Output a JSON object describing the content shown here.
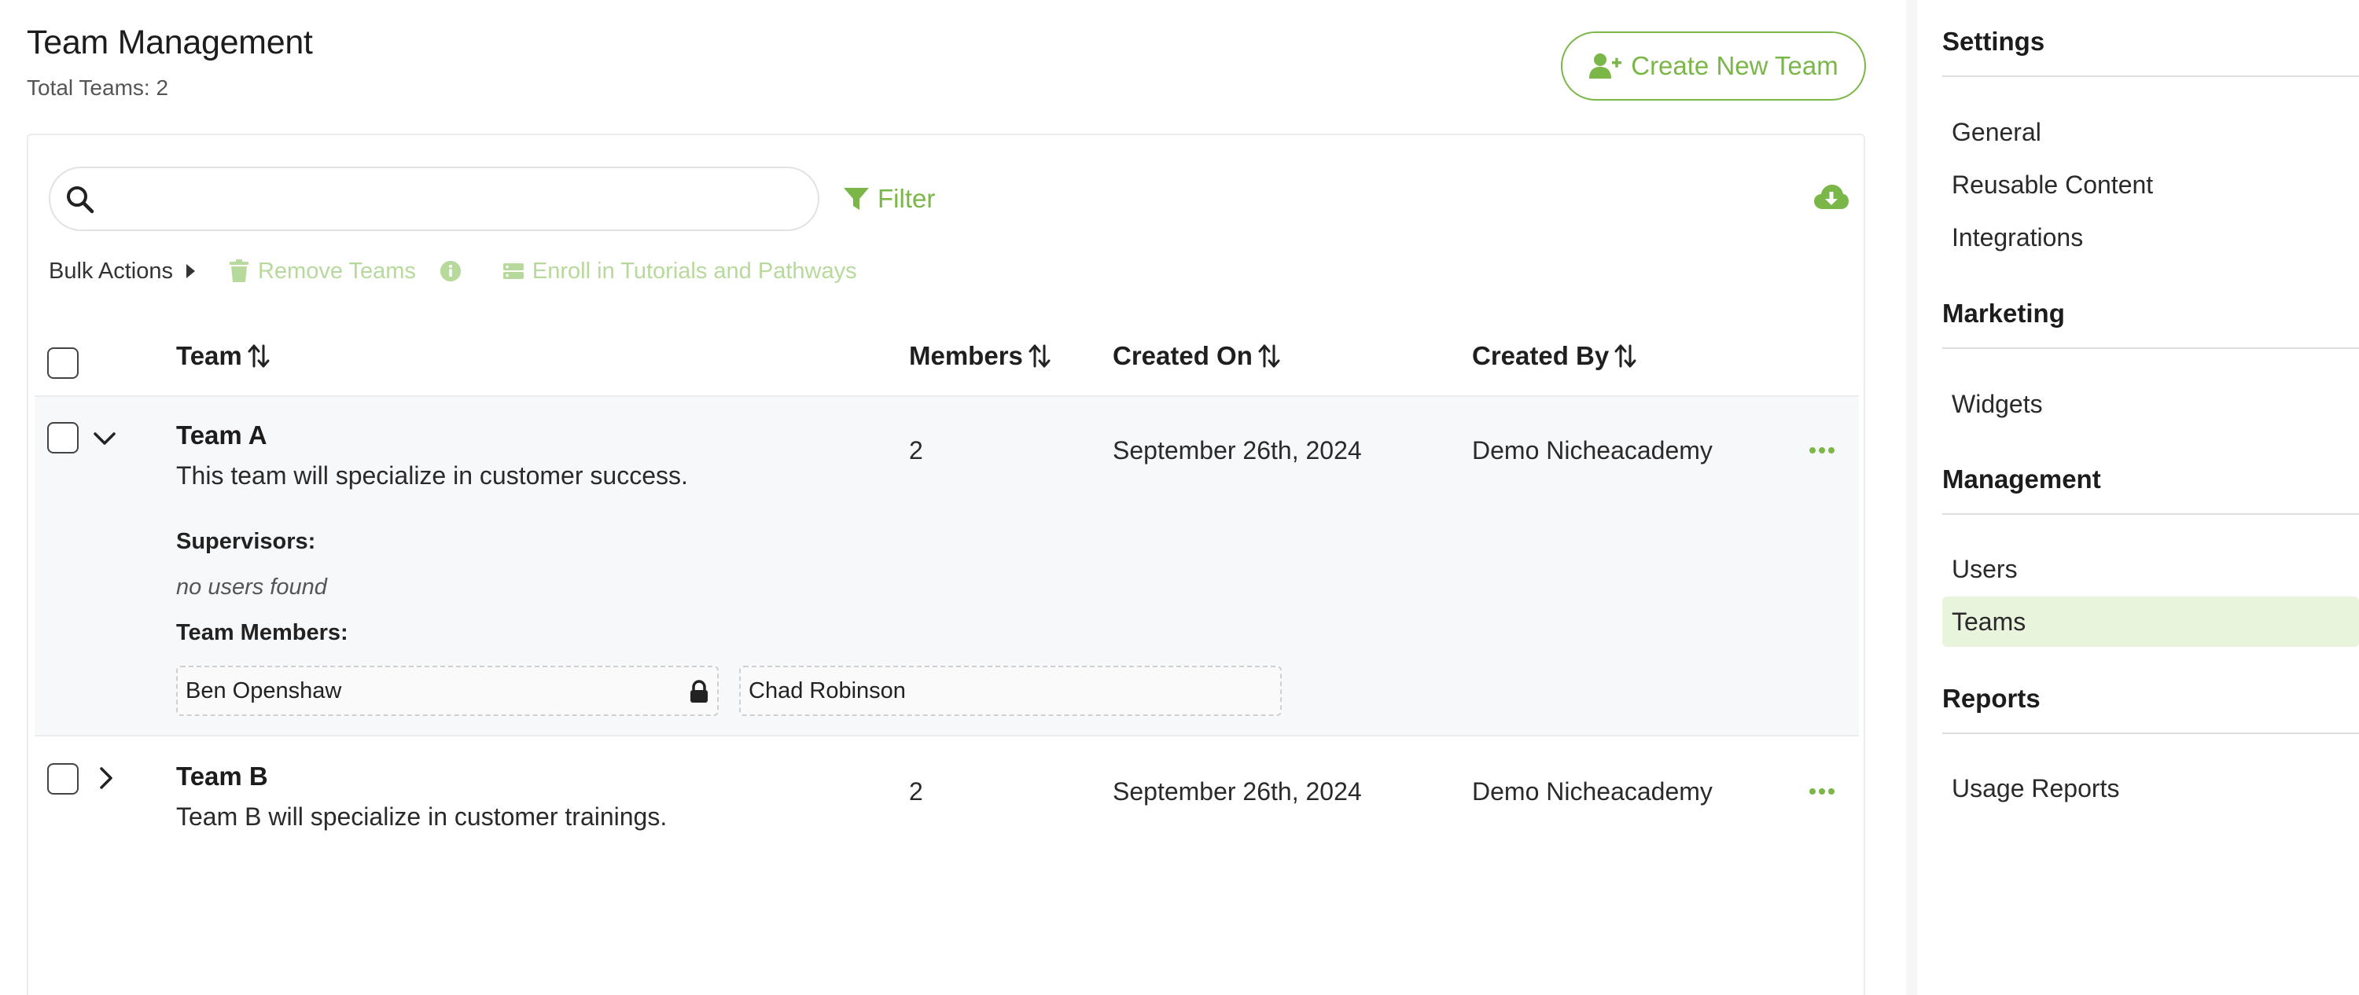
{
  "header": {
    "title": "Team Management",
    "subtitle": "Total Teams: 2",
    "create_button": "Create New Team"
  },
  "toolbar": {
    "search_placeholder": "",
    "filter_label": "Filter"
  },
  "bulk_actions": {
    "label": "Bulk Actions",
    "remove_label": "Remove Teams",
    "enroll_label": "Enroll in Tutorials and Pathways"
  },
  "table": {
    "columns": {
      "team": "Team",
      "members": "Members",
      "created_on": "Created On",
      "created_by": "Created By"
    },
    "rows": [
      {
        "name": "Team A",
        "description": "This team will specialize in customer success.",
        "members": "2",
        "created_on": "September 26th, 2024",
        "created_by": "Demo Nicheacademy",
        "expanded": true,
        "supervisors_label": "Supervisors:",
        "no_supervisors": "no users found",
        "team_members_label": "Team Members:",
        "team_members": [
          "Ben Openshaw",
          "Chad Robinson"
        ]
      },
      {
        "name": "Team B",
        "description": "Team B will specialize in customer trainings.",
        "members": "2",
        "created_on": "September 26th, 2024",
        "created_by": "Demo Nicheacademy",
        "expanded": false
      }
    ]
  },
  "sidebar": {
    "sections": [
      {
        "title": "Settings",
        "items": [
          "General",
          "Reusable Content",
          "Integrations"
        ]
      },
      {
        "title": "Marketing",
        "items": [
          "Widgets"
        ]
      },
      {
        "title": "Management",
        "items": [
          "Users",
          "Teams"
        ]
      },
      {
        "title": "Reports",
        "items": [
          "Usage Reports"
        ]
      }
    ],
    "active_item": "Teams"
  },
  "colors": {
    "accent": "#7ab648",
    "accent_disabled": "#b7d99c",
    "active_bg": "#e8f4dc"
  }
}
